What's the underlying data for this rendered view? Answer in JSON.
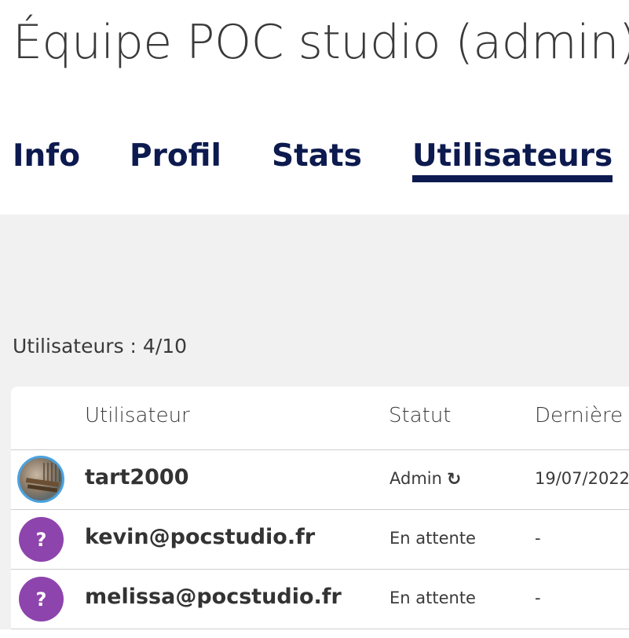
{
  "header": {
    "title": "Équipe POC studio (admin)"
  },
  "tabs": [
    {
      "label": "Info",
      "active": false
    },
    {
      "label": "Profil",
      "active": false
    },
    {
      "label": "Stats",
      "active": false
    },
    {
      "label": "Utilisateurs",
      "active": true
    }
  ],
  "users_panel": {
    "count_label": "Utilisateurs : 4/10",
    "columns": {
      "user": "Utilisateur",
      "status": "Statut",
      "last": "Dernière c"
    },
    "rows": [
      {
        "avatar": "photo",
        "name": "tart2000",
        "status": "Admin",
        "status_icon": "refresh-icon",
        "last": "19/07/2022"
      },
      {
        "avatar": "?",
        "name": "kevin@pocstudio.fr",
        "status": "En attente",
        "last": "-"
      },
      {
        "avatar": "?",
        "name": "melissa@pocstudio.fr",
        "status": "En attente",
        "last": "-"
      }
    ]
  },
  "colors": {
    "tab_text": "#0c1a4f",
    "avatar_unknown": "#8e44ad",
    "avatar_border": "#4aa3e0",
    "background_gray": "#f1f1f1"
  }
}
